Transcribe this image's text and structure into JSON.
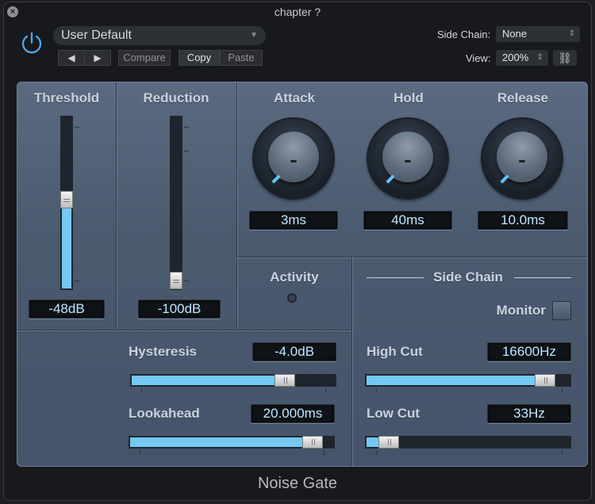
{
  "window": {
    "title": "chapter ?",
    "footer_title": "Noise Gate"
  },
  "header": {
    "preset": "User Default",
    "nav": {
      "back": "◀",
      "forward": "▶"
    },
    "buttons": {
      "compare": "Compare",
      "copy": "Copy",
      "paste": "Paste"
    },
    "side_chain_label": "Side Chain:",
    "side_chain_value": "None",
    "view_label": "View:",
    "view_value": "200%"
  },
  "threshold": {
    "label": "Threshold",
    "readout": "-48dB",
    "level": 0.52
  },
  "reduction": {
    "label": "Reduction",
    "readout": "-100dB",
    "level": 0.0
  },
  "attack": {
    "label": "Attack",
    "readout": "3ms"
  },
  "hold": {
    "label": "Hold",
    "readout": "40ms"
  },
  "release": {
    "label": "Release",
    "readout": "10.0ms"
  },
  "activity": {
    "label": "Activity"
  },
  "hysteresis": {
    "label": "Hysteresis",
    "readout": "-4.0dB",
    "level": 0.78
  },
  "lookahead": {
    "label": "Lookahead",
    "readout": "20.000ms",
    "level": 0.94
  },
  "side_chain": {
    "label": "Side Chain",
    "monitor_label": "Monitor",
    "high_cut": {
      "label": "High Cut",
      "readout": "16600Hz",
      "level": 0.92
    },
    "low_cut": {
      "label": "Low Cut",
      "readout": "33Hz",
      "level": 0.07
    }
  },
  "icons": [
    "close-icon",
    "power-icon",
    "link-icon",
    "dropdown-caret-icon"
  ],
  "colors": {
    "accent": "#73c9f2",
    "panel": "#4f5f74",
    "readout_text": "#bfe6ff"
  }
}
